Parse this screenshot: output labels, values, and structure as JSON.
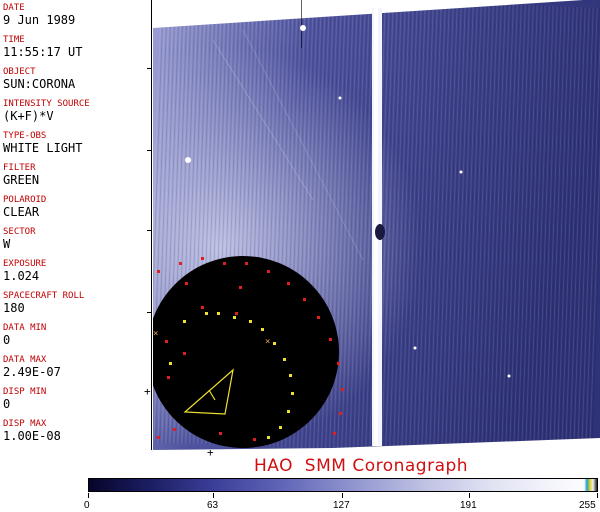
{
  "metadata": {
    "fields": [
      {
        "label": "DATE",
        "value": "9 Jun 1989"
      },
      {
        "label": "TIME",
        "value": "11:55:17 UT"
      },
      {
        "label": "OBJECT",
        "value": "SUN:CORONA"
      },
      {
        "label": "INTENSITY SOURCE",
        "value": "(K+F)*V"
      },
      {
        "label": "TYPE-OBS",
        "value": "WHITE LIGHT"
      },
      {
        "label": "FILTER",
        "value": "GREEN"
      },
      {
        "label": "POLAROID",
        "value": "CLEAR"
      },
      {
        "label": "SECTOR",
        "value": "W"
      },
      {
        "label": "EXPOSURE",
        "value": "1.024"
      },
      {
        "label": "SPACECRAFT ROLL",
        "value": "180"
      },
      {
        "label": "DATA MIN",
        "value": "0"
      },
      {
        "label": "DATA MAX",
        "value": "2.49E-07"
      },
      {
        "label": "DISP MIN",
        "value": "0"
      },
      {
        "label": "DISP MAX",
        "value": "1.00E-08"
      }
    ]
  },
  "caption": "HAO  SMM Coronagraph",
  "colorbar": {
    "ticks": [
      "0",
      "63",
      "127",
      "191",
      "255"
    ],
    "colors": {
      "dark": "#05052a",
      "mid": "#6065b8",
      "light": "#fbfbff"
    }
  },
  "colors": {
    "label_red": "#c00000",
    "caption_red": "#d01010",
    "occulter": "#000000",
    "marker_red": "#e02020",
    "marker_yellow": "#f0e030"
  }
}
